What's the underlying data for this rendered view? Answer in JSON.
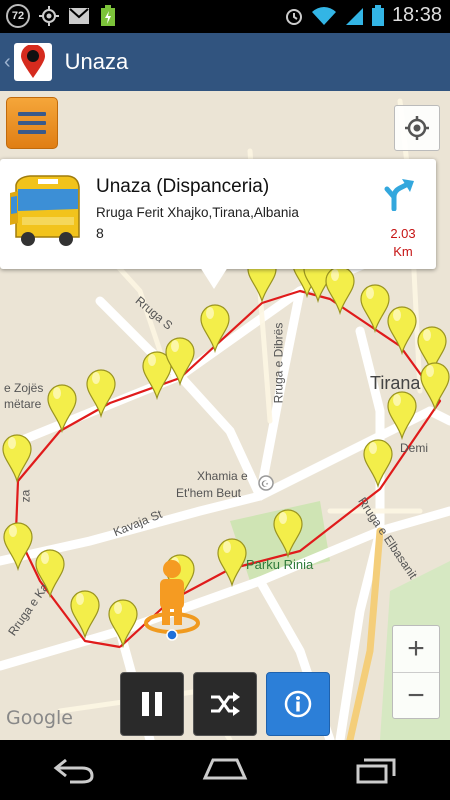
{
  "status_bar": {
    "notification_badge": "72",
    "time": "18:38",
    "icons": [
      "badge-icon",
      "gps-icon",
      "gmail-icon",
      "battery-charging-icon",
      "alarm-icon",
      "wifi-icon",
      "signal-icon",
      "battery-icon"
    ]
  },
  "action_bar": {
    "title": "Unaza",
    "app_icon": "map-pin-icon"
  },
  "popup": {
    "title": "Unaza (Dispanceria)",
    "address": "Rruga Ferit Xhajko,Tirana,Albania",
    "number": "8",
    "distance_value": "2.03",
    "distance_unit": "Km"
  },
  "map": {
    "labels": {
      "rruga_s": "Rruga S",
      "rruga_dibres": "Rruga e Dibrës",
      "tirana": "Tirana",
      "e_zojes": "e Zojës",
      "metare": "mëtare",
      "demi": "Demi",
      "xhamia": "Xhamia e",
      "ethem": "Et'hem Beut",
      "kavaja_st": "Kavaja St",
      "parku": "Parku Rinia",
      "rruga_kavajes": "Rruga e Kavajës",
      "rruga_elbasanit": "Rruga e Elbasanit",
      "za": "za"
    },
    "google": "Google",
    "route_color": "#e01b1b",
    "marker_color": "#f3ee4a"
  },
  "controls": {
    "zoom_in": "+",
    "zoom_out": "−",
    "pause_icon": "pause-icon",
    "shuffle_icon": "shuffle-icon",
    "info_icon": "info-icon"
  },
  "nav_bar": {
    "icons": [
      "back-icon",
      "home-icon",
      "recent-apps-icon"
    ]
  }
}
